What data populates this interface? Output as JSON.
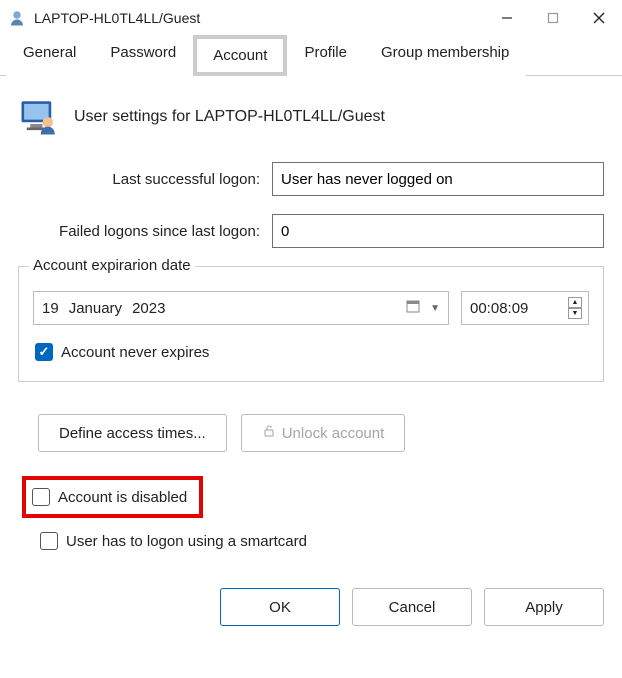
{
  "window": {
    "title": "LAPTOP-HL0TL4LL/Guest"
  },
  "tabs": {
    "general": "General",
    "password": "Password",
    "account": "Account",
    "profile": "Profile",
    "groupmembership": "Group membership"
  },
  "header": {
    "text": "User settings for LAPTOP-HL0TL4LL/Guest"
  },
  "fields": {
    "lastlogon_label": "Last successful logon:",
    "lastlogon_value": "User has never logged on",
    "failed_label": "Failed logons since last logon:",
    "failed_value": "0"
  },
  "expire": {
    "legend": "Account expirarion date",
    "day": "19",
    "month": "January",
    "year": "2023",
    "time": "00:08:09",
    "never_label": "Account never expires"
  },
  "buttons": {
    "define_access": "Define access times...",
    "unlock": "Unlock account"
  },
  "checkboxes": {
    "disabled_label": "Account is disabled",
    "smartcard_label": "User has to logon using a smartcard"
  },
  "footer": {
    "ok": "OK",
    "cancel": "Cancel",
    "apply": "Apply"
  }
}
